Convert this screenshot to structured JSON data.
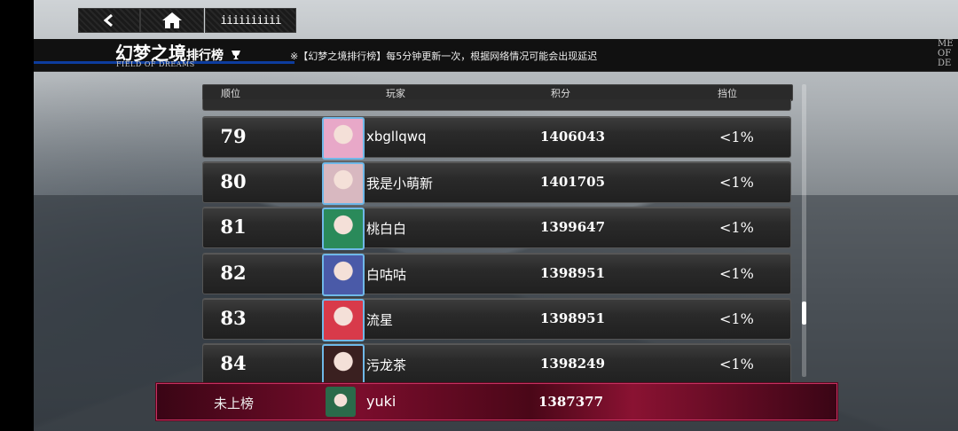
{
  "nav": {
    "title_button": "iiiiiiiiii"
  },
  "header": {
    "title": "幻梦之境",
    "title_suffix": "排行榜",
    "subtitle": "FIELD OF DREAMS",
    "notice": "※【幻梦之境排行榜】每5分钟更新一次，根据网络情况可能会出现延迟",
    "side_text": "ME\nOF\nDE"
  },
  "columns": {
    "rank": "顺位",
    "player": "玩家",
    "score": "积分",
    "tier": "挡位"
  },
  "rows": [
    {
      "rank": "79",
      "name": "xbgllqwq",
      "score": "1406043",
      "tier": "<1%",
      "avatar_color": "#e8a8c8"
    },
    {
      "rank": "80",
      "name": "我是小萌新",
      "score": "1401705",
      "tier": "<1%",
      "avatar_color": "#d8b8c0"
    },
    {
      "rank": "81",
      "name": "桃白白",
      "score": "1399647",
      "tier": "<1%",
      "avatar_color": "#2a8a5a"
    },
    {
      "rank": "82",
      "name": "白咕咕",
      "score": "1398951",
      "tier": "<1%",
      "avatar_color": "#4a5aa8"
    },
    {
      "rank": "83",
      "name": "流星",
      "score": "1398951",
      "tier": "<1%",
      "avatar_color": "#d83a4a"
    },
    {
      "rank": "84",
      "name": "污龙茶",
      "score": "1398249",
      "tier": "<1%",
      "avatar_color": "#3a2020"
    }
  ],
  "my_entry": {
    "rank": "未上榜",
    "name": "yuki",
    "score": "1387377",
    "avatar_color": "#2a6a4a"
  },
  "colors": {
    "accent_blue": "#0d3c9e",
    "my_row": "#7a0d2c"
  }
}
